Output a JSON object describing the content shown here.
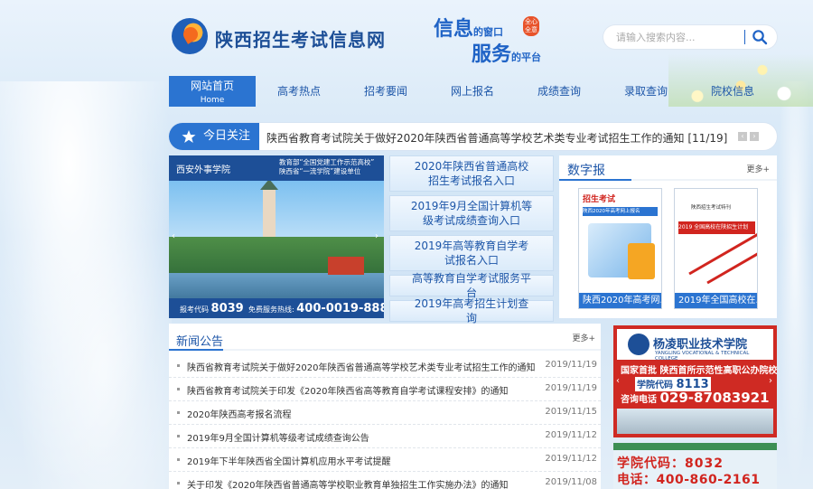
{
  "header": {
    "site_title": "陕西招生考试信息网",
    "slogan_line1": "信息",
    "slogan_line1_mid": "的窗口",
    "slogan_line2": "服务",
    "slogan_line2_mid": "的平台",
    "slogan_badge": "全心全意",
    "search_placeholder": "请输入搜索内容...",
    "search_icon": "search-icon"
  },
  "nav": {
    "items": [
      {
        "label": "网站首页",
        "sub": "Home"
      },
      {
        "label": "高考热点"
      },
      {
        "label": "招考要闻"
      },
      {
        "label": "网上报名"
      },
      {
        "label": "成绩查询"
      },
      {
        "label": "录取查询"
      },
      {
        "label": "院校信息"
      }
    ]
  },
  "today": {
    "label": "今日关注",
    "text": "陕西省教育考试院关于做好2020年陕西省普通高等学校艺术类专业考试招生工作的通知",
    "date": "[11/19]",
    "prev": "‹",
    "next": "›"
  },
  "banner": {
    "school": "西安外事学院",
    "note_line1": "教育部“全国党建工作示范高校”",
    "note_line2": "陕西省“一流学院”建设单位",
    "code_label": "报考代码",
    "code": "8039",
    "hotline_label": "免费服务热线:",
    "hotline": "400-0019-888",
    "prev": "‹",
    "next": "›"
  },
  "quick_links": [
    "2020年陕西省普通高校招生考试报名入口",
    "2019年9月全国计算机等级考试成绩查询入口",
    "2019年高等教育自学考试报名入口",
    "高等教育自学考试服务平台",
    "2019年高考招生计划查询"
  ],
  "digital": {
    "title": "数字报",
    "more": "更多+",
    "papers": [
      {
        "caption": "陕西2020年高考网...",
        "masthead": "招生考试",
        "headline": "陕西2020年高考网上报名"
      },
      {
        "caption": "2019年全国高校在...",
        "masthead": "陕西招生考试特刊",
        "headline": "2019 全国高校在陕招生计划"
      }
    ]
  },
  "news": {
    "title": "新闻公告",
    "more": "更多+",
    "items": [
      {
        "text": "陕西省教育考试院关于做好2020年陕西省普通高等学校艺术类专业考试招生工作的通知",
        "date": "2019/11/19"
      },
      {
        "text": "陕西省教育考试院关于印发《2020年陕西省高等教育自学考试课程安排》的通知",
        "date": "2019/11/19"
      },
      {
        "text": "2020年陕西高考报名流程",
        "date": "2019/11/15"
      },
      {
        "text": "2019年9月全国计算机等级考试成绩查询公告",
        "date": "2019/11/12"
      },
      {
        "text": "2019年下半年陕西省全国计算机应用水平考试提醒",
        "date": "2019/11/12"
      },
      {
        "text": "关于印发《2020年陕西省普通高等学校职业教育单独招生工作实施办法》的通知",
        "date": "2019/11/08"
      }
    ]
  },
  "ads": {
    "ad1_name": "杨凌职业技术学院",
    "ad1_en": "YANGLING VOCATIONAL & TECHNICAL COLLEGE",
    "ad1_slogan": "国家首批 陕西首所示范性高职公办院校",
    "ad1_code_label": "学院代码",
    "ad1_code": "8113",
    "ad1_phone_label": "咨询电话",
    "ad1_phone": "029-87083921",
    "ad2_line1": "学院代码：8032",
    "ad2_line2": "电话：400-860-2161"
  },
  "colors": {
    "primary": "#2b74d1",
    "title_blue": "#1d4f97",
    "ad_red": "#cf2a23"
  }
}
